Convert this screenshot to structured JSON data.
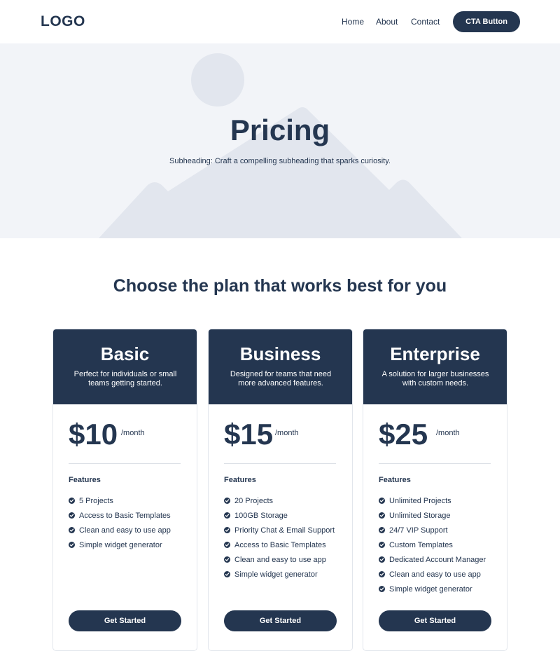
{
  "header": {
    "logo": "LOGO",
    "nav": [
      "Home",
      "About",
      "Contact"
    ],
    "cta": "CTA Button"
  },
  "hero": {
    "title": "Pricing",
    "subheading": "Subheading: Craft a compelling subheading that sparks curiosity."
  },
  "section": {
    "title": "Choose the plan that works best for you"
  },
  "plans": [
    {
      "name": "Basic",
      "description": "Perfect for individuals or small teams getting started.",
      "price": "$10",
      "period": "/month",
      "features_title": "Features",
      "features": [
        "5 Projects",
        "Access to Basic Templates",
        "Clean and easy to use app",
        "Simple widget generator"
      ],
      "button": "Get Started"
    },
    {
      "name": "Business",
      "description": "Designed for teams that need more advanced features.",
      "price": "$15",
      "period": "/month",
      "features_title": "Features",
      "features": [
        "20 Projects",
        "100GB Storage",
        "Priority Chat & Email Support",
        "Access to Basic Templates",
        "Clean and easy to use app",
        "Simple widget generator"
      ],
      "button": "Get Started"
    },
    {
      "name": "Enterprise",
      "description": "A solution for larger businesses with custom needs.",
      "price": "$25",
      "period": "/month",
      "features_title": "Features",
      "features": [
        "Unlimited Projects",
        "Unlimited Storage",
        "24/7 VIP Support",
        "Custom Templates",
        "Dedicated Account Manager",
        "Clean and easy to use app",
        "Simple widget generator"
      ],
      "button": "Get Started"
    }
  ],
  "colors": {
    "primary": "#243650",
    "hero_bg": "#f2f4f8",
    "placeholder": "#e2e6ee"
  },
  "icons": {
    "check": "check-circle-icon",
    "hero_image": "image-placeholder-icon"
  }
}
